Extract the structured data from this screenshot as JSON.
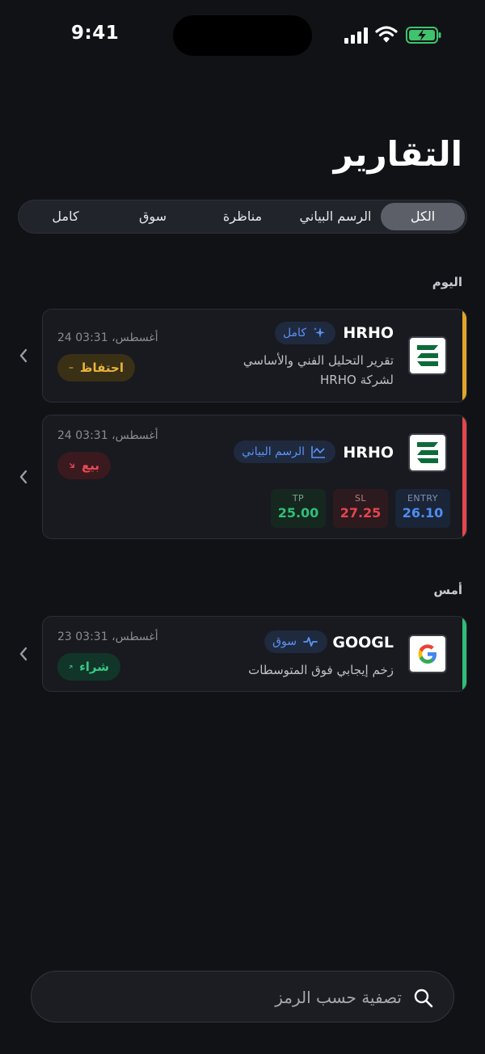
{
  "status": {
    "time": "9:41"
  },
  "header": {
    "title": "التقارير"
  },
  "filters": [
    {
      "label": "الكل",
      "active": true
    },
    {
      "label": "الرسم البياني",
      "active": false
    },
    {
      "label": "مناظرة",
      "active": false
    },
    {
      "label": "سوق",
      "active": false
    },
    {
      "label": "كامل",
      "active": false
    }
  ],
  "sections": [
    {
      "label": "اليوم",
      "cards": [
        {
          "symbol": "HRHO",
          "tag": "كامل",
          "tag_icon": "sparkle-icon",
          "description": [
            "تقرير التحليل الفني والأساسي",
            "لشركة HRHO"
          ],
          "date": "24 أغسطس، 03:31",
          "action": "احتفاظ",
          "action_icon": "minus-icon",
          "accent": "#e3a528"
        },
        {
          "symbol": "HRHO",
          "tag": "الرسم البياني",
          "tag_icon": "chart-icon",
          "date": "24 أغسطس، 03:31",
          "action": "بيع",
          "action_icon": "arrow-down-right-icon",
          "accent": "#e5454f",
          "metrics": {
            "entry_label": "ENTRY",
            "entry": "26.10",
            "sl_label": "SL",
            "sl": "27.25",
            "tp_label": "TP",
            "tp": "25.00"
          }
        }
      ]
    },
    {
      "label": "أمس",
      "cards": [
        {
          "symbol": "GOOGL",
          "tag": "سوق",
          "tag_icon": "pulse-icon",
          "description": [
            "زخم إيجابي فوق المتوسطات"
          ],
          "date": "23 أغسطس، 03:31",
          "action": "شراء",
          "action_icon": "arrow-up-right-icon",
          "accent": "#2fbf79"
        }
      ]
    }
  ],
  "search": {
    "placeholder": "تصفية حسب الرمز"
  },
  "colors": {
    "background": "#111216",
    "card": "#181a1f",
    "accent_blue": "#5b93f5"
  }
}
